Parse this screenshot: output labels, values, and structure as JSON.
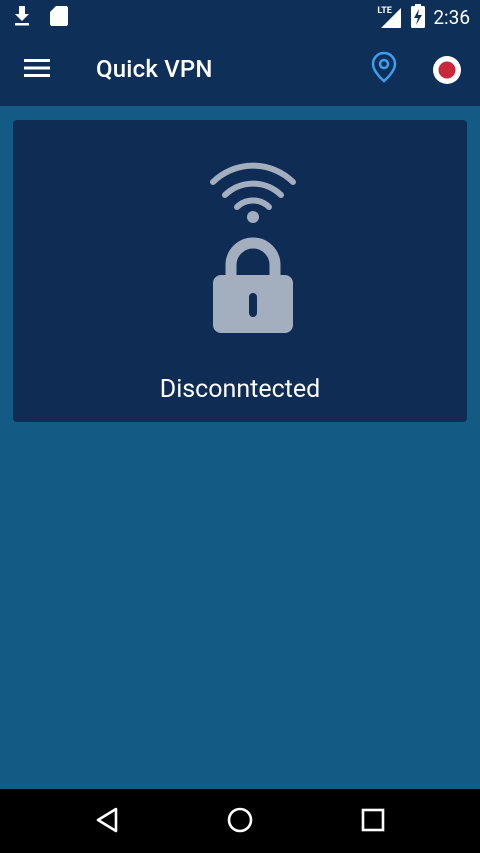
{
  "status_bar": {
    "time": "2:36",
    "network_label": "LTE",
    "left_icons": [
      "download-icon",
      "sd-card-icon"
    ],
    "right_icons": [
      "signal-icon",
      "battery-charging-icon"
    ]
  },
  "app_bar": {
    "title": "Quick VPN",
    "actions": [
      "location-pin-icon",
      "record-icon"
    ],
    "accent_color": "#3ba0f0",
    "record_color": "#c8283a"
  },
  "main": {
    "connection_status": "Disconntected",
    "icons": [
      "wifi-icon",
      "lock-icon"
    ],
    "icon_color": "#a3aebe"
  },
  "nav_bar": {
    "buttons": [
      "back-icon",
      "home-icon",
      "recents-icon"
    ]
  },
  "colors": {
    "primary_dark": "#0d2f58",
    "background": "#135b85",
    "card": "#0f2c55"
  }
}
